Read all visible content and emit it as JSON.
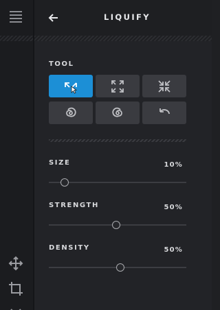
{
  "header": {
    "title": "LIQUIFY",
    "back_icon": "arrow-left-icon"
  },
  "left_rail": {
    "top_icon": "layers-icon",
    "bottom_icons": [
      "move-icon",
      "crop-icon",
      "chevron-down-icon"
    ]
  },
  "tool_section": {
    "label": "TOOL",
    "tools": [
      {
        "icon": "expand-arrows-icon",
        "active": true
      },
      {
        "icon": "bloat-icon",
        "active": false
      },
      {
        "icon": "pinch-icon",
        "active": false
      },
      {
        "icon": "twirl-left-icon",
        "active": false
      },
      {
        "icon": "twirl-right-icon",
        "active": false
      },
      {
        "icon": "undo-icon",
        "active": false
      }
    ]
  },
  "sliders": [
    {
      "label": "SIZE",
      "value_text": "10%",
      "value": 0.1
    },
    {
      "label": "STRENGTH",
      "value_text": "50%",
      "value": 0.5
    },
    {
      "label": "DENSITY",
      "value_text": "50%",
      "value": 0.5
    }
  ],
  "colors": {
    "accent": "#1c8fd6",
    "panel": "#222327",
    "button": "#3a3b40"
  }
}
